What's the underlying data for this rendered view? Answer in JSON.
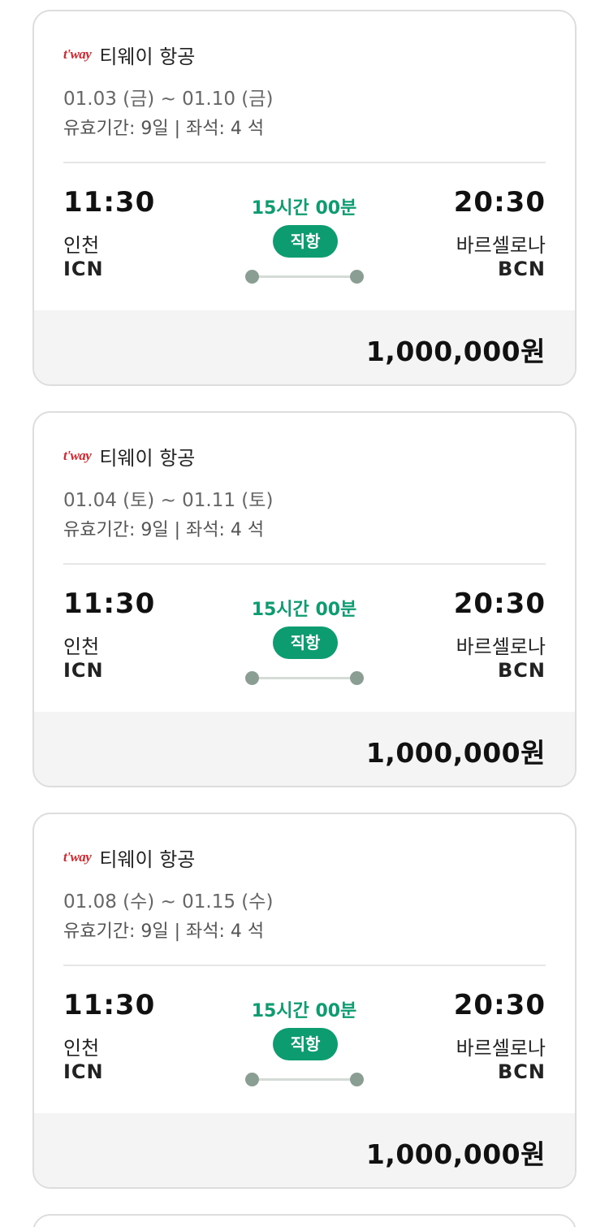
{
  "flights": [
    {
      "airline_logo": "t'way",
      "airline_name": "티웨이 항공",
      "dates": "01.03 (금) ~ 01.10 (금)",
      "validity": "유효기간: 9일 | 좌석: 4 석",
      "departure_time": "11:30",
      "departure_city": "인천",
      "departure_code": "ICN",
      "duration": "15시간 00분",
      "flight_type": "직항",
      "arrival_time": "20:30",
      "arrival_city": "바르셀로나",
      "arrival_code": "BCN",
      "price": "1,000,000원"
    },
    {
      "airline_logo": "t'way",
      "airline_name": "티웨이 항공",
      "dates": "01.04 (토) ~ 01.11 (토)",
      "validity": "유효기간: 9일 | 좌석: 4 석",
      "departure_time": "11:30",
      "departure_city": "인천",
      "departure_code": "ICN",
      "duration": "15시간 00분",
      "flight_type": "직항",
      "arrival_time": "20:30",
      "arrival_city": "바르셀로나",
      "arrival_code": "BCN",
      "price": "1,000,000원"
    },
    {
      "airline_logo": "t'way",
      "airline_name": "티웨이 항공",
      "dates": "01.08 (수) ~ 01.15 (수)",
      "validity": "유효기간: 9일 | 좌석: 4 석",
      "departure_time": "11:30",
      "departure_city": "인천",
      "departure_code": "ICN",
      "duration": "15시간 00분",
      "flight_type": "직항",
      "arrival_time": "20:30",
      "arrival_city": "바르셀로나",
      "arrival_code": "BCN",
      "price": "1,000,000원"
    }
  ],
  "colors": {
    "accent_green": "#0d9c6f",
    "logo_red": "#d6262d",
    "price_bar_bg": "#f4f4f4"
  }
}
